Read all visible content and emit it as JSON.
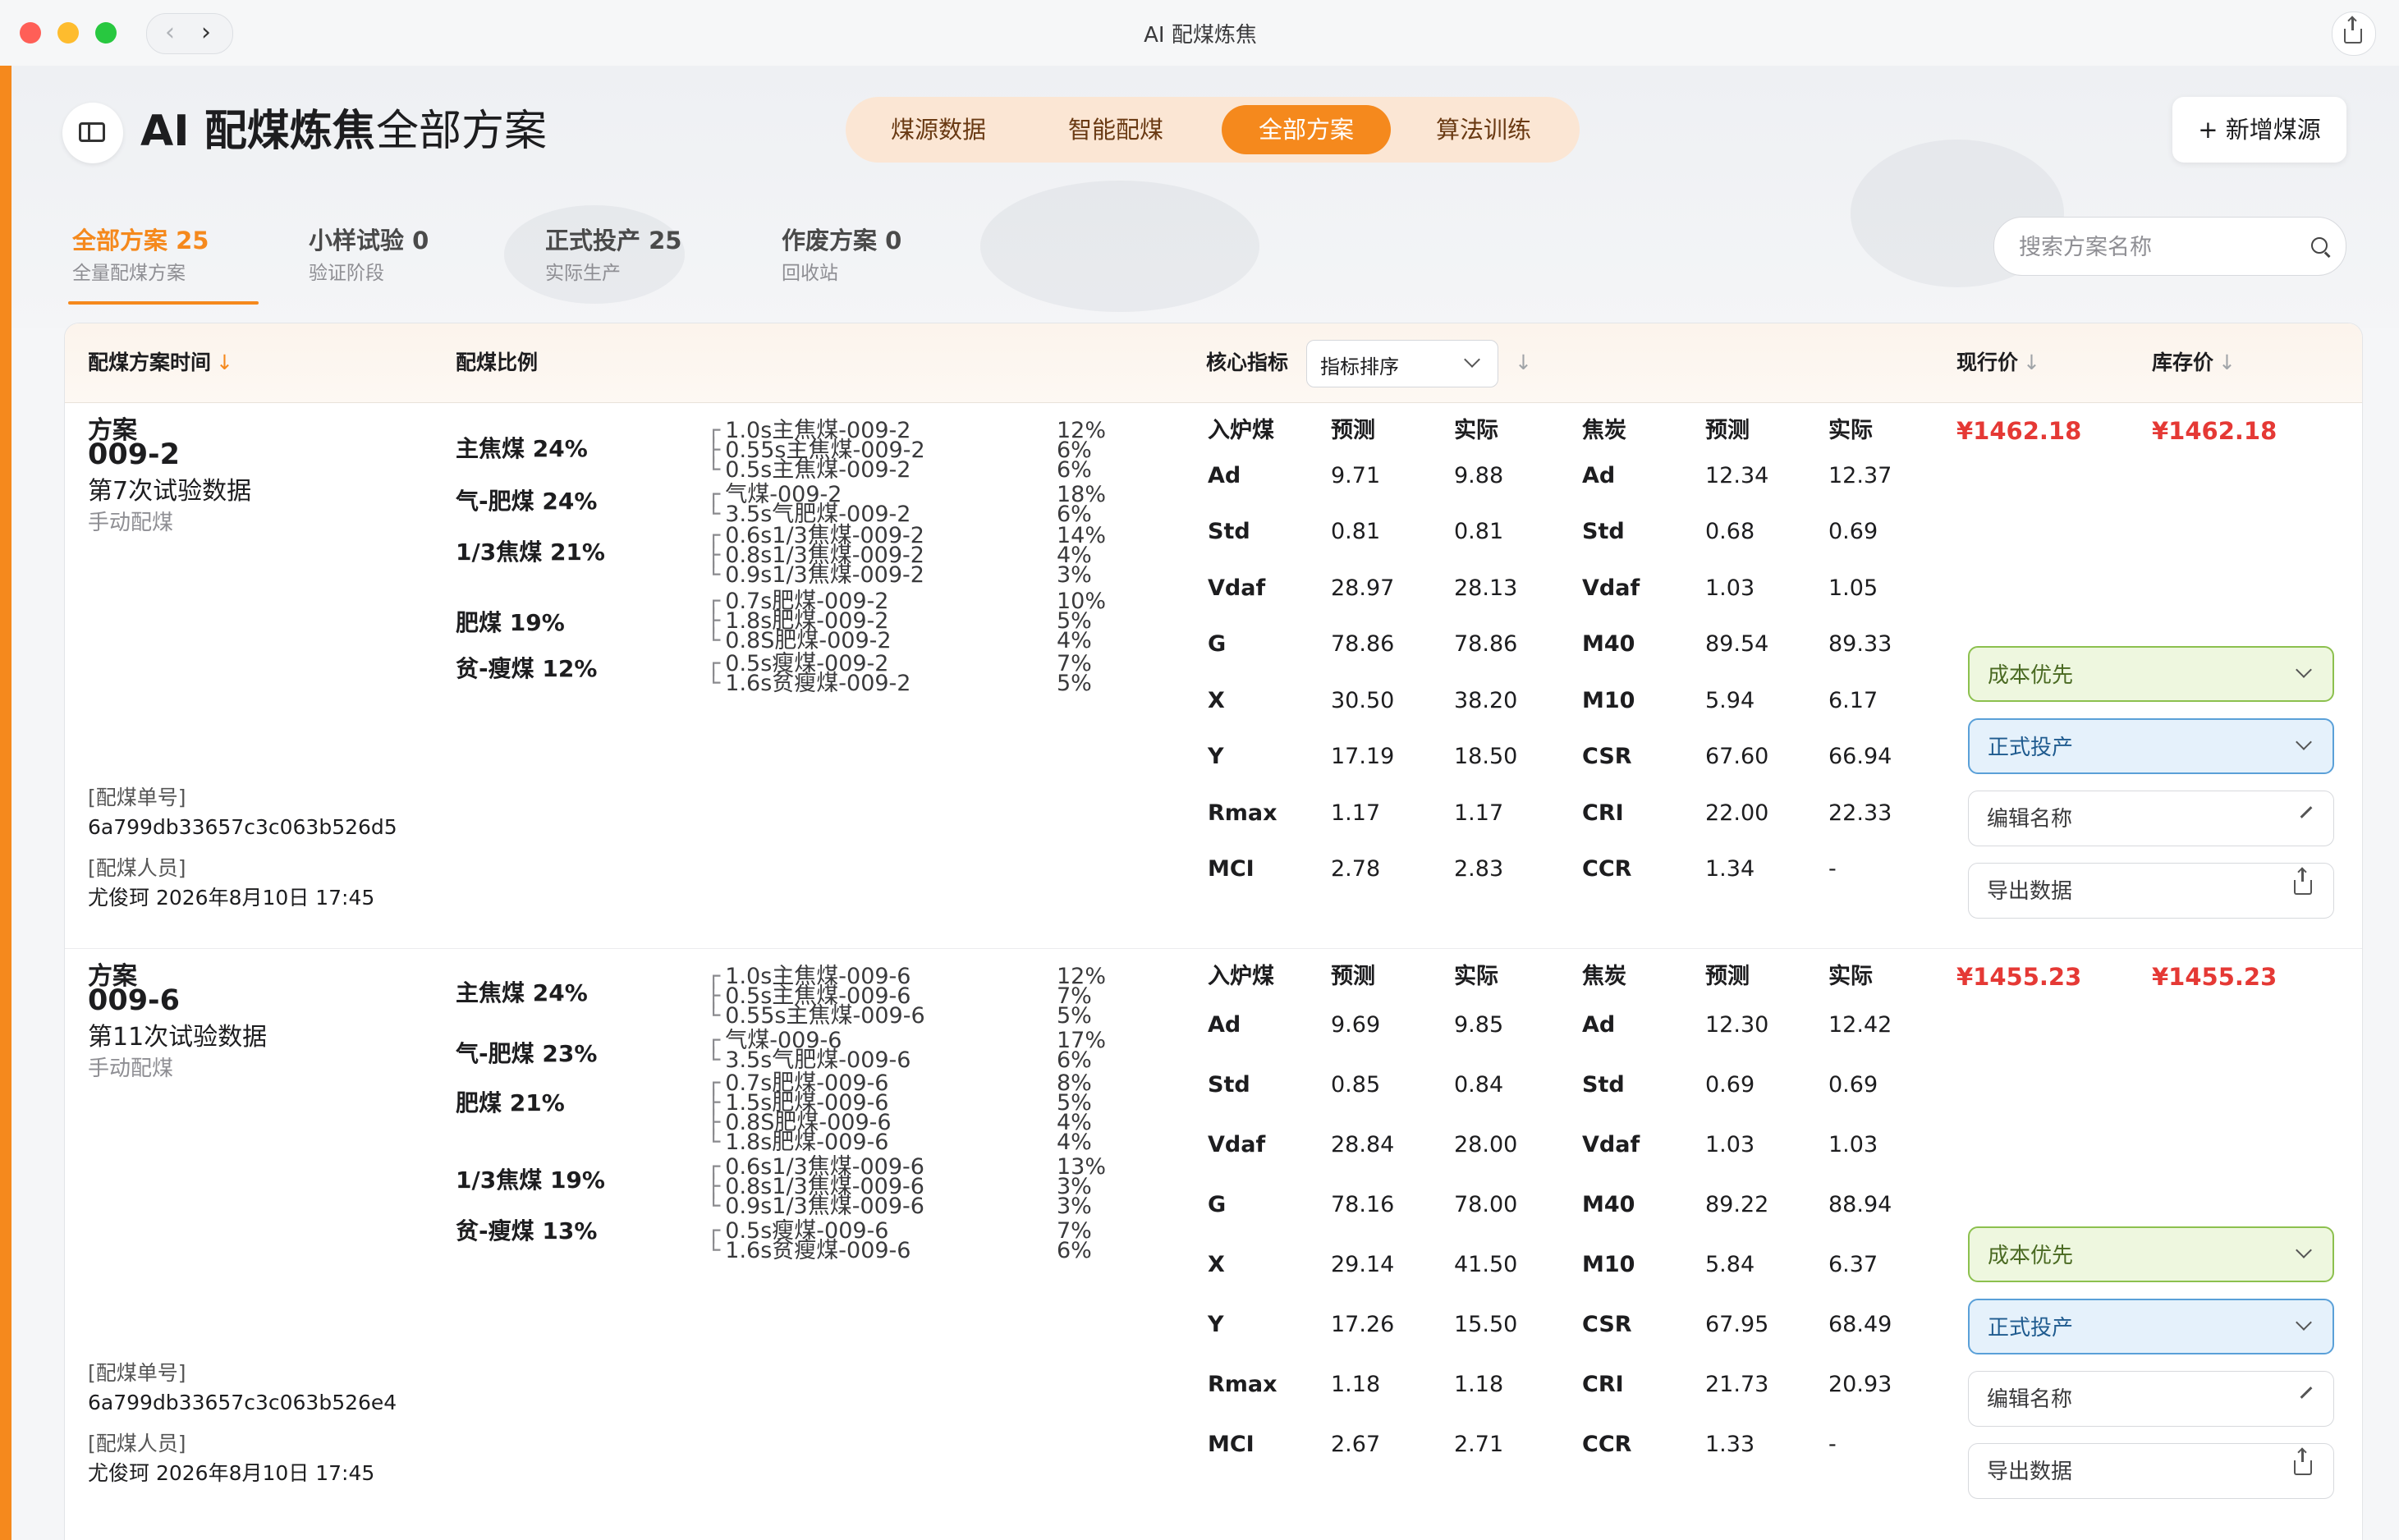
{
  "window": {
    "title": "AI 配煤炼焦"
  },
  "header": {
    "app_name": "AI 配煤炼焦",
    "page_name": "全部方案",
    "add_button": "+ 新增煤源"
  },
  "nav_tabs": [
    {
      "label": "煤源数据",
      "active": false
    },
    {
      "label": "智能配煤",
      "active": false
    },
    {
      "label": "全部方案",
      "active": true
    },
    {
      "label": "算法训练",
      "active": false
    }
  ],
  "filter_tabs": [
    {
      "title": "全部方案 25",
      "sub": "全量配煤方案",
      "active": true
    },
    {
      "title": "小样试验 0",
      "sub": "验证阶段",
      "active": false
    },
    {
      "title": "正式投产 25",
      "sub": "实际生产",
      "active": false
    },
    {
      "title": "作废方案 0",
      "sub": "回收站",
      "active": false
    }
  ],
  "search": {
    "placeholder": "搜索方案名称"
  },
  "table_header": {
    "time": "配煤方案时间",
    "ratio": "配煤比例",
    "core": "核心指标",
    "sort_select": "指标排序",
    "current_price": "现行价",
    "stock_price": "库存价"
  },
  "colors": {
    "accent": "#f5891d",
    "price": "#e53935",
    "green": "#8cc04e",
    "blue": "#5aa0d8"
  },
  "plans": [
    {
      "label": "方案",
      "id": "009-2",
      "trial": "第7次试验数据",
      "mode": "手动配煤",
      "order_label": "[配煤单号]",
      "order_no": "6a799db33657c3c063b526d5",
      "staff_label": "[配煤人员]",
      "staff": "尤俊珂 2026年8月10日 17:45",
      "groups": [
        {
          "name": "主焦煤 24%",
          "items": [
            {
              "tree": "┌",
              "name": "1.0s主焦煤-009-2",
              "pct": "12%"
            },
            {
              "tree": "├",
              "name": "0.55s主焦煤-009-2",
              "pct": "6%"
            },
            {
              "tree": "└",
              "name": "0.5s主焦煤-009-2",
              "pct": "6%"
            }
          ]
        },
        {
          "name": "气-肥煤 24%",
          "items": [
            {
              "tree": "┌",
              "name": "气煤-009-2",
              "pct": "18%"
            },
            {
              "tree": "└",
              "name": "3.5s气肥煤-009-2",
              "pct": "6%"
            }
          ]
        },
        {
          "name": "1/3焦煤 21%",
          "items": [
            {
              "tree": "┌",
              "name": "0.6s1/3焦煤-009-2",
              "pct": "14%"
            },
            {
              "tree": "├",
              "name": "0.8s1/3焦煤-009-2",
              "pct": "4%"
            },
            {
              "tree": "└",
              "name": "0.9s1/3焦煤-009-2",
              "pct": "3%"
            }
          ]
        },
        {
          "name": "肥煤 19%",
          "items": [
            {
              "tree": "┌",
              "name": "0.7s肥煤-009-2",
              "pct": "10%"
            },
            {
              "tree": "├",
              "name": "1.8s肥煤-009-2",
              "pct": "5%"
            },
            {
              "tree": "└",
              "name": "0.8S肥煤-009-2",
              "pct": "4%"
            }
          ]
        },
        {
          "name": "贫-瘦煤 12%",
          "items": [
            {
              "tree": "┌",
              "name": "0.5s瘦煤-009-2",
              "pct": "7%"
            },
            {
              "tree": "└",
              "name": "1.6s贫瘦煤-009-2",
              "pct": "5%"
            }
          ]
        }
      ],
      "metrics_header": [
        "入炉煤",
        "预测",
        "实际",
        "焦炭",
        "预测",
        "实际"
      ],
      "metrics": [
        [
          "Ad",
          "9.71",
          "9.88",
          "Ad",
          "12.34",
          "12.37"
        ],
        [
          "Std",
          "0.81",
          "0.81",
          "Std",
          "0.68",
          "0.69"
        ],
        [
          "Vdaf",
          "28.97",
          "28.13",
          "Vdaf",
          "1.03",
          "1.05"
        ],
        [
          "G",
          "78.86",
          "78.86",
          "M40",
          "89.54",
          "89.33"
        ],
        [
          "X",
          "30.50",
          "38.20",
          "M10",
          "5.94",
          "6.17"
        ],
        [
          "Y",
          "17.19",
          "18.50",
          "CSR",
          "67.60",
          "66.94"
        ],
        [
          "Rmax",
          "1.17",
          "1.17",
          "CRI",
          "22.00",
          "22.33"
        ],
        [
          "MCI",
          "2.78",
          "2.83",
          "CCR",
          "1.34",
          "-"
        ]
      ],
      "current_price": "¥1462.18",
      "stock_price": "¥1462.18",
      "strategy": "成本优先",
      "status": "正式投产",
      "edit_label": "编辑名称",
      "export_label": "导出数据"
    },
    {
      "label": "方案",
      "id": "009-6",
      "trial": "第11次试验数据",
      "mode": "手动配煤",
      "order_label": "[配煤单号]",
      "order_no": "6a799db33657c3c063b526e4",
      "staff_label": "[配煤人员]",
      "staff": "尤俊珂 2026年8月10日 17:45",
      "groups": [
        {
          "name": "主焦煤 24%",
          "items": [
            {
              "tree": "┌",
              "name": "1.0s主焦煤-009-6",
              "pct": "12%"
            },
            {
              "tree": "├",
              "name": "0.5s主焦煤-009-6",
              "pct": "7%"
            },
            {
              "tree": "└",
              "name": "0.55s主焦煤-009-6",
              "pct": "5%"
            }
          ]
        },
        {
          "name": "气-肥煤 23%",
          "items": [
            {
              "tree": "┌",
              "name": "气煤-009-6",
              "pct": "17%"
            },
            {
              "tree": "└",
              "name": "3.5s气肥煤-009-6",
              "pct": "6%"
            }
          ]
        },
        {
          "name": "肥煤 21%",
          "items": [
            {
              "tree": "┌",
              "name": "0.7s肥煤-009-6",
              "pct": "8%"
            },
            {
              "tree": "├",
              "name": "1.5s肥煤-009-6",
              "pct": "5%"
            },
            {
              "tree": "├",
              "name": "0.8S肥煤-009-6",
              "pct": "4%"
            },
            {
              "tree": "└",
              "name": "1.8s肥煤-009-6",
              "pct": "4%"
            }
          ]
        },
        {
          "name": "1/3焦煤 19%",
          "items": [
            {
              "tree": "┌",
              "name": "0.6s1/3焦煤-009-6",
              "pct": "13%"
            },
            {
              "tree": "├",
              "name": "0.8s1/3焦煤-009-6",
              "pct": "3%"
            },
            {
              "tree": "└",
              "name": "0.9s1/3焦煤-009-6",
              "pct": "3%"
            }
          ]
        },
        {
          "name": "贫-瘦煤 13%",
          "items": [
            {
              "tree": "┌",
              "name": "0.5s瘦煤-009-6",
              "pct": "7%"
            },
            {
              "tree": "└",
              "name": "1.6s贫瘦煤-009-6",
              "pct": "6%"
            }
          ]
        }
      ],
      "metrics_header": [
        "入炉煤",
        "预测",
        "实际",
        "焦炭",
        "预测",
        "实际"
      ],
      "metrics": [
        [
          "Ad",
          "9.69",
          "9.85",
          "Ad",
          "12.30",
          "12.42"
        ],
        [
          "Std",
          "0.85",
          "0.84",
          "Std",
          "0.69",
          "0.69"
        ],
        [
          "Vdaf",
          "28.84",
          "28.00",
          "Vdaf",
          "1.03",
          "1.03"
        ],
        [
          "G",
          "78.16",
          "78.00",
          "M40",
          "89.22",
          "88.94"
        ],
        [
          "X",
          "29.14",
          "41.50",
          "M10",
          "5.84",
          "6.37"
        ],
        [
          "Y",
          "17.26",
          "15.50",
          "CSR",
          "67.95",
          "68.49"
        ],
        [
          "Rmax",
          "1.18",
          "1.18",
          "CRI",
          "21.73",
          "20.93"
        ],
        [
          "MCI",
          "2.67",
          "2.71",
          "CCR",
          "1.33",
          "-"
        ]
      ],
      "current_price": "¥1455.23",
      "stock_price": "¥1455.23",
      "strategy": "成本优先",
      "status": "正式投产",
      "edit_label": "编辑名称",
      "export_label": "导出数据"
    }
  ]
}
